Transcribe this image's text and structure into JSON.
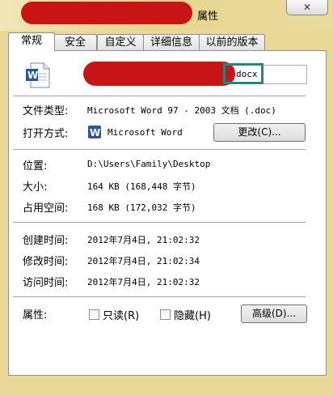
{
  "window": {
    "title": "属性",
    "close": "✕"
  },
  "tabs": [
    {
      "label": "常规"
    },
    {
      "label": "安全"
    },
    {
      "label": "自定义"
    },
    {
      "label": "详细信息"
    },
    {
      "label": "以前的版本"
    }
  ],
  "file": {
    "name_visible": "docx"
  },
  "type": {
    "label": "文件类型:",
    "value": "Microsoft Word 97 - 2003 文档 (.doc)"
  },
  "open": {
    "label": "打开方式:",
    "app": "Microsoft Word",
    "change_button": "更改(C)..."
  },
  "location": {
    "label": "位置:",
    "value": "D:\\Users\\Family\\Desktop"
  },
  "size": {
    "label": "大小:",
    "value": "164 KB (168,448 字节)"
  },
  "disk": {
    "label": "占用空间:",
    "value": "168 KB (172,032 字节)"
  },
  "created": {
    "label": "创建时间:",
    "value": "2012年7月4日, 21:02:32"
  },
  "modified": {
    "label": "修改时间:",
    "value": "2012年7月4日, 21:02:34"
  },
  "accessed": {
    "label": "访问时间:",
    "value": "2012年7月4日, 21:02:32"
  },
  "attributes": {
    "label": "属性:",
    "readonly": "只读(R)",
    "readonly_checked": false,
    "hidden": "隐藏(H)",
    "hidden_checked": false,
    "advanced_button": "高级(D)..."
  },
  "colors": {
    "redaction": "#c81414",
    "focus_border": "#1e8a7a",
    "word_blue": "#2b5797"
  },
  "icons": [
    "close-icon",
    "word-document-icon",
    "word-app-icon"
  ]
}
